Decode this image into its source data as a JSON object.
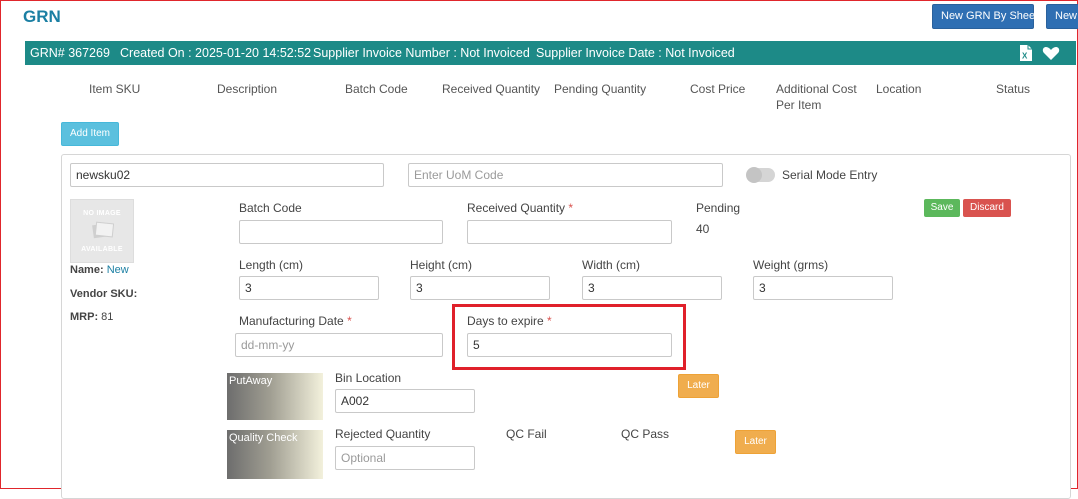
{
  "page": {
    "title": "GRN"
  },
  "top_buttons": {
    "new_by_sheet": "New GRN By Sheet",
    "new": "New"
  },
  "header": {
    "grn": "GRN# 367269",
    "created_on": "Created On : 2025-01-20 14:52:52",
    "supplier_invoice_number": "Supplier Invoice Number : Not Invoiced",
    "supplier_invoice_date": "Supplier Invoice Date : Not Invoiced",
    "icons": [
      "excel-icon",
      "heart-icon"
    ],
    "color": "#1d8a87"
  },
  "columns": {
    "item_sku": "Item SKU",
    "description": "Description",
    "batch_code": "Batch Code",
    "received_quantity": "Received Quantity",
    "pending_quantity": "Pending Quantity",
    "cost_price": "Cost Price",
    "additional_cost_1": "Additional Cost",
    "additional_cost_2": "Per Item",
    "location": "Location",
    "status": "Status"
  },
  "add_item_label": "Add Item",
  "item": {
    "sku_value": "newsku02",
    "uom_placeholder": "Enter UoM Code",
    "serial_mode_label": "Serial Mode Entry",
    "no_image_1": "NO IMAGE",
    "no_image_2": "AVAILABLE",
    "name_label": "Name:",
    "name_value": "New",
    "vendor_sku_label": "Vendor SKU:",
    "mrp_label": "MRP:",
    "mrp_value": "81",
    "batch_code_label": "Batch Code",
    "batch_code_value": "",
    "received_quantity_label": "Received Quantity",
    "received_quantity_value": "",
    "required_mark": "*",
    "pending_label": "Pending",
    "pending_value": "40",
    "save_label": "Save",
    "discard_label": "Discard",
    "length_label": "Length (cm)",
    "length_value": "3",
    "height_label": "Height (cm)",
    "height_value": "3",
    "width_label": "Width (cm)",
    "width_value": "3",
    "weight_label": "Weight (grms)",
    "weight_value": "3",
    "mfg_date_label": "Manufacturing Date",
    "mfg_date_placeholder": "dd-mm-yy",
    "days_to_expire_label": "Days to expire",
    "days_to_expire_value": "5",
    "putaway_label": "PutAway",
    "bin_location_label": "Bin Location",
    "bin_location_value": "A002",
    "later_label": "Later",
    "quality_check_label": "Quality Check",
    "rejected_quantity_label": "Rejected Quantity",
    "rejected_quantity_placeholder": "Optional",
    "qc_fail_label": "QC Fail",
    "qc_pass_label": "QC Pass"
  },
  "colors": {
    "title": "#1b7fa3",
    "primary_button": "#2f6fb3",
    "info_button": "#5bc0de",
    "success": "#5cb85c",
    "danger": "#d9534f",
    "warning": "#f0ad4e",
    "highlight": "#e0202a"
  }
}
